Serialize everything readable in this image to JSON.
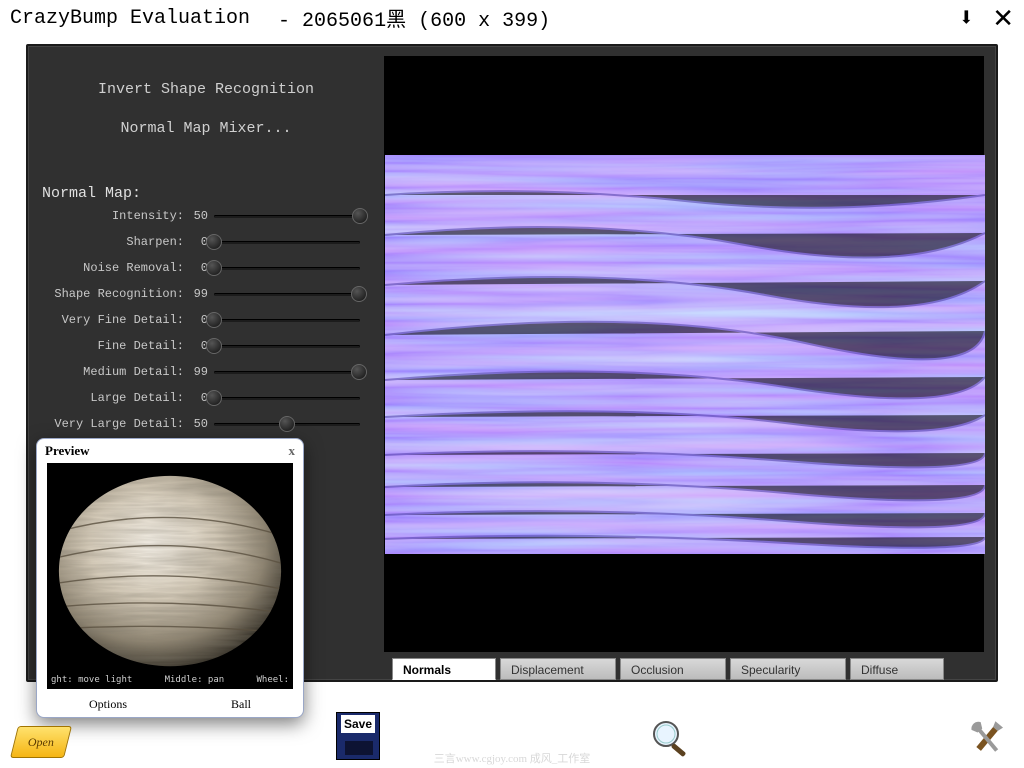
{
  "titlebar": {
    "app": "CrazyBump Evaluation",
    "file": "- 2065061黑 (600 x 399)"
  },
  "left": {
    "invert": "Invert Shape Recognition",
    "mixer": "Normal Map Mixer...",
    "section": "Normal Map:",
    "sliders": [
      {
        "label": "Intensity:",
        "value": 50,
        "min": 0,
        "max": 50
      },
      {
        "label": "Sharpen:",
        "value": 0,
        "min": 0,
        "max": 100
      },
      {
        "label": "Noise Removal:",
        "value": 0,
        "min": 0,
        "max": 100
      },
      {
        "label": "Shape Recognition:",
        "value": 99,
        "min": 0,
        "max": 100
      },
      {
        "label": "Very Fine Detail:",
        "value": 0,
        "min": 0,
        "max": 100
      },
      {
        "label": "Fine Detail:",
        "value": 0,
        "min": 0,
        "max": 100
      },
      {
        "label": "Medium Detail:",
        "value": 99,
        "min": 0,
        "max": 100
      },
      {
        "label": "Large Detail:",
        "value": 0,
        "min": 0,
        "max": 100
      },
      {
        "label": "Very Large Detail:",
        "value": 50,
        "min": 0,
        "max": 100
      }
    ]
  },
  "tabs": {
    "items": [
      "Normals",
      "Displacement",
      "Occlusion",
      "Specularity",
      "Diffuse"
    ],
    "active": 0
  },
  "preview": {
    "title": "Preview",
    "hints": [
      "ght: move light",
      "Middle: pan",
      "Wheel:"
    ],
    "options": "Options",
    "ball": "Ball"
  },
  "buttons": {
    "open": "Open",
    "save": "Save"
  },
  "watermark": "三言www.cgjoy.com 成风_工作室"
}
